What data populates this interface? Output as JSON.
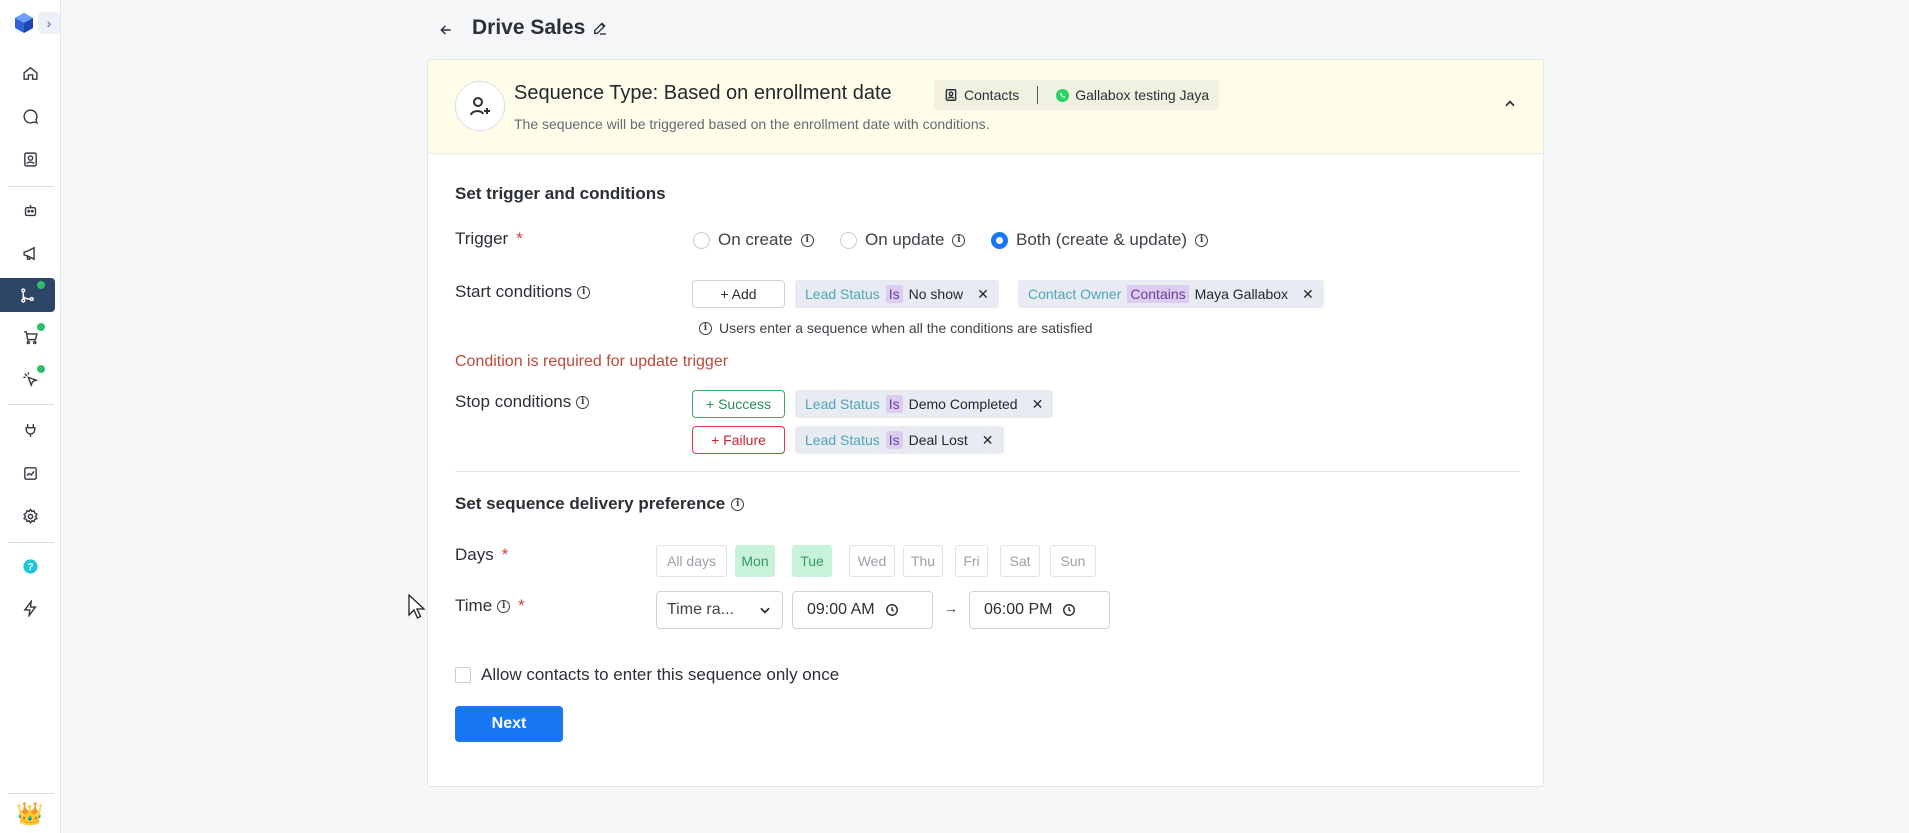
{
  "page": {
    "title": "Drive Sales"
  },
  "sequence": {
    "type_title": "Sequence Type: Based on enrollment date",
    "description": "The sequence will be triggered based on the enrollment date with conditions.",
    "contacts_label": "Contacts",
    "channel_label": "Gallabox testing Jaya"
  },
  "trigger_section": {
    "title": "Set trigger and conditions",
    "trigger_label": "Trigger",
    "required_mark": "*",
    "options": [
      "On create",
      "On update",
      "Both (create & update)"
    ],
    "selected_option": "Both (create & update)",
    "start_label": "Start conditions",
    "add_label": "+ Add",
    "start_conditions": [
      {
        "field": "Lead Status",
        "op": "Is",
        "value": "No show"
      },
      {
        "field": "Contact Owner",
        "op": "Contains",
        "value": "Maya Gallabox"
      }
    ],
    "start_note": "Users enter a sequence when all the conditions are satisfied",
    "error_text": "Condition is required for update trigger",
    "stop_label": "Stop conditions",
    "success_label": "+ Success",
    "failure_label": "+ Failure",
    "success_condition": {
      "field": "Lead Status",
      "op": "Is",
      "value": "Demo Completed"
    },
    "failure_condition": {
      "field": "Lead Status",
      "op": "Is",
      "value": "Deal Lost"
    }
  },
  "delivery_section": {
    "title": "Set sequence delivery preference",
    "days_label": "Days",
    "days": [
      {
        "label": "All days",
        "selected": false
      },
      {
        "label": "Mon",
        "selected": true
      },
      {
        "label": "Tue",
        "selected": true
      },
      {
        "label": "Wed",
        "selected": false
      },
      {
        "label": "Thu",
        "selected": false
      },
      {
        "label": "Fri",
        "selected": false
      },
      {
        "label": "Sat",
        "selected": false
      },
      {
        "label": "Sun",
        "selected": false
      }
    ],
    "time_label": "Time",
    "time_mode": "Time ra...",
    "start_time": "09:00 AM",
    "end_time": "06:00 PM",
    "arrow": "→"
  },
  "once_checkbox": {
    "label": "Allow contacts to enter this sequence only once",
    "checked": false
  },
  "next_button": "Next",
  "colors": {
    "accent": "#1877f2",
    "sidebar_active": "#2d4566",
    "selected_day": "#c8f2d9",
    "header_bg": "#fefde9",
    "error": "#b94a3c"
  },
  "icons": [
    "cube-logo-icon",
    "chevron-right-icon",
    "home-icon",
    "chat-icon",
    "contacts-book-icon",
    "bot-icon",
    "megaphone-icon",
    "flow-icon",
    "cart-icon",
    "pointer-click-icon",
    "plug-icon",
    "chart-icon",
    "settings-icon",
    "help-icon",
    "bolt-icon",
    "crown-avatar-icon"
  ]
}
